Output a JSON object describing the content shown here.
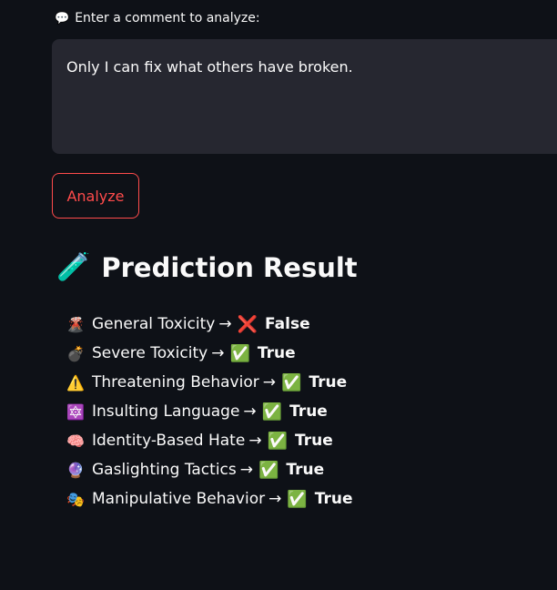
{
  "input": {
    "label_icon": "💬",
    "label": "Enter a comment to analyze:",
    "value": "Only I can fix what others have broken."
  },
  "button": {
    "label": "Analyze"
  },
  "result": {
    "heading_icon": "🧪",
    "heading": "Prediction Result",
    "arrow": "→",
    "items": [
      {
        "icon": "🌋",
        "label": "General Toxicity",
        "mark": "❌",
        "value": "False"
      },
      {
        "icon": "💣",
        "label": "Severe Toxicity",
        "mark": "✅",
        "value": "True"
      },
      {
        "icon": "⚠️",
        "label": "Threatening Behavior",
        "mark": "✅",
        "value": "True"
      },
      {
        "icon": "🔯",
        "label": "Insulting Language",
        "mark": "✅",
        "value": "True"
      },
      {
        "icon": "🧠",
        "label": "Identity-Based Hate",
        "mark": "✅",
        "value": "True"
      },
      {
        "icon": "🔮",
        "label": "Gaslighting Tactics",
        "mark": "✅",
        "value": "True"
      },
      {
        "icon": "🎭",
        "label": "Manipulative Behavior",
        "mark": "✅",
        "value": "True"
      }
    ]
  }
}
